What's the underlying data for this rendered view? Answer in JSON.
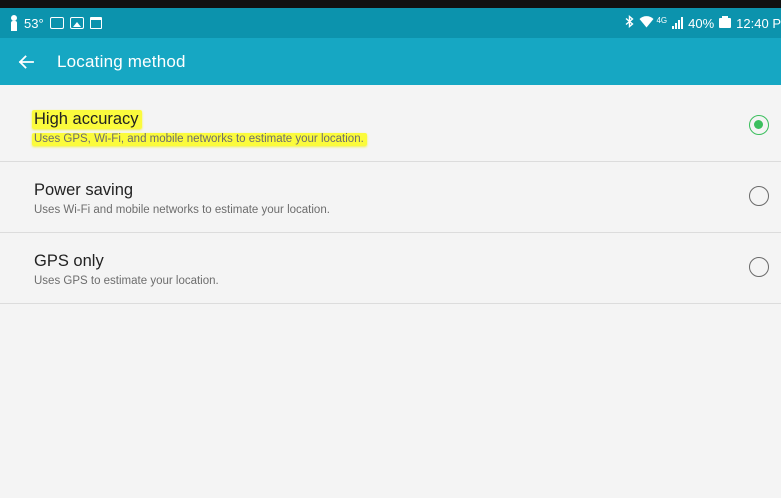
{
  "status_bar": {
    "temperature": "53°",
    "network": "4G",
    "battery_percent": "40%",
    "time": "12:40 P"
  },
  "app_bar": {
    "title": "Locating method"
  },
  "options": [
    {
      "title": "High accuracy",
      "description": "Uses GPS, Wi-Fi, and mobile networks to estimate your location.",
      "selected": true
    },
    {
      "title": "Power saving",
      "description": "Uses Wi-Fi and mobile networks to estimate your location.",
      "selected": false
    },
    {
      "title": "GPS only",
      "description": "Uses GPS to estimate your location.",
      "selected": false
    }
  ],
  "colors": {
    "status_bar": "#0c93ad",
    "app_bar": "#16a7c3",
    "radio_selected": "#3cbf5e",
    "highlight": "#fbfb3c"
  }
}
